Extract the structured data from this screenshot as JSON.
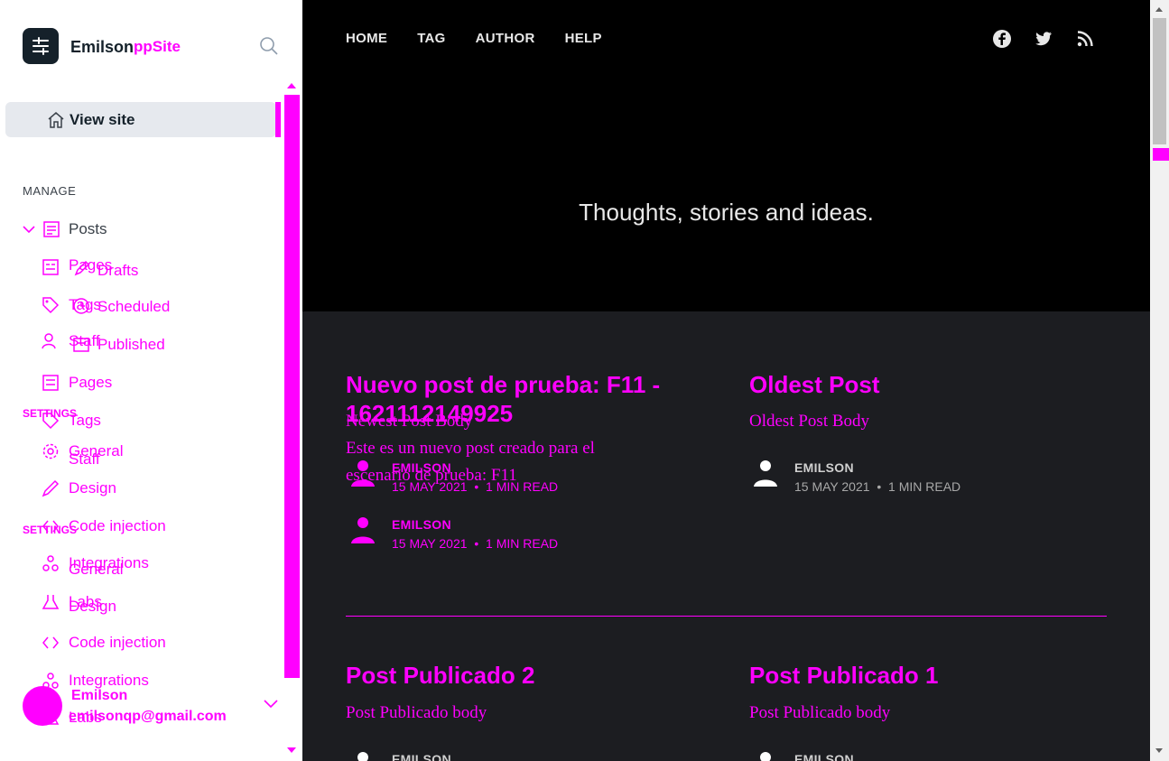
{
  "sidebar": {
    "brand_name": "Emilson",
    "brand_overlay": "ppSite",
    "view_site": "View site",
    "manage_label": "MANAGE",
    "settings_label": "SETTINGS",
    "nav_posts": "Posts",
    "nav_drafts": "Drafts",
    "nav_scheduled": "Scheduled",
    "nav_published": "Published",
    "nav_pages": "Pages",
    "nav_tags": "Tags",
    "nav_staff": "Staff",
    "nav_general": "General",
    "nav_design": "Design",
    "nav_code_injection": "Code injection",
    "nav_integrations": "Integrations",
    "nav_labs": "Labs",
    "ghost_pages": "Pages",
    "ghost_tags": "Tags",
    "ghost_staff": "Staff",
    "user_name": "Emilson",
    "user_email": "emilsonqp@gmail.com"
  },
  "topnav": {
    "home": "HOME",
    "tag": "TAG",
    "author": "AUTHOR",
    "help": "HELP"
  },
  "hero": {
    "tagline": "Thoughts, stories and ideas."
  },
  "posts": {
    "p1_title": "Nuevo post de prueba: F11 - 1621112149925",
    "p1_excerpt_a": "Newest Post Body",
    "p1_excerpt_b": "Este es un nuevo post creado para el escenario de prueba: F11",
    "p1_author": "EMILSON",
    "p1_date": "15 MAY 2021",
    "p1_read": "1 MIN READ",
    "p1_author_b": "EMILSON",
    "p1_date_b": "15 MAY 2021",
    "p1_read_b": "1 MIN READ",
    "p2_title": "Oldest Post",
    "p2_excerpt": "Oldest Post Body",
    "p2_author": "EMILSON",
    "p2_date": "15 MAY 2021",
    "p2_read": "1 MIN READ",
    "p3_title": "Post Publicado 2",
    "p3_excerpt": "Post Publicado body",
    "p3_author": "EMILSON",
    "p4_title": "Post Publicado 1",
    "p4_excerpt": "Post Publicado body",
    "p4_author": "EMILSON"
  },
  "colors": {
    "accent": "#ff00ff",
    "hero_bg": "#000000",
    "body_bg": "#1c1d21",
    "sidebar_bg": "#ffffff"
  },
  "icons": [
    "search-icon",
    "home-icon",
    "chevron-down-icon",
    "posts-icon",
    "pen-icon",
    "clock-icon",
    "published-icon",
    "pages-icon",
    "tag-icon",
    "staff-icon",
    "gear-icon",
    "design-icon",
    "code-icon",
    "integrations-icon",
    "labs-icon",
    "facebook-icon",
    "twitter-icon",
    "rss-icon",
    "user-icon"
  ]
}
